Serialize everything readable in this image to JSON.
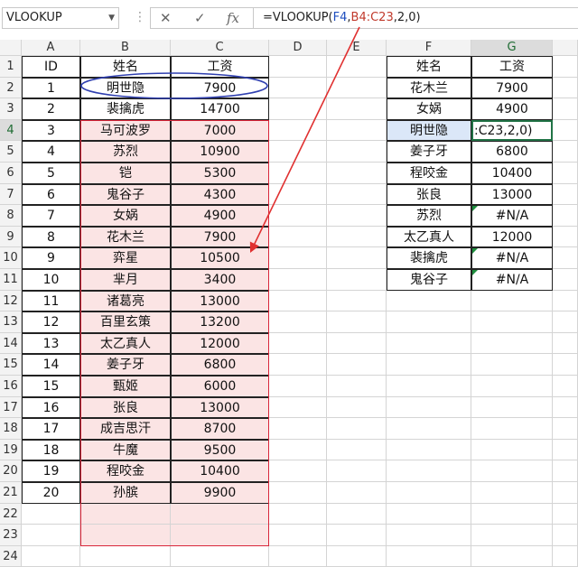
{
  "formula_bar": {
    "name_box": "VLOOKUP",
    "cancel_icon": "✕",
    "enter_icon": "✓",
    "fx_label": "fx",
    "formula_parts": [
      "=VLOOKUP(",
      "F4",
      ",",
      "B4:C23",
      ",2,0)"
    ]
  },
  "columns": [
    "A",
    "B",
    "C",
    "D",
    "E",
    "F",
    "G"
  ],
  "rows": [
    "1",
    "2",
    "3",
    "4",
    "5",
    "6",
    "7",
    "8",
    "9",
    "10",
    "11",
    "12",
    "13",
    "14",
    "15",
    "16",
    "17",
    "18",
    "19",
    "20",
    "21",
    "22",
    "23",
    "24"
  ],
  "left_table": {
    "headers": [
      "ID",
      "姓名",
      "工资"
    ],
    "rows": [
      [
        "1",
        "明世隐",
        "7900"
      ],
      [
        "2",
        "裴擒虎",
        "14700"
      ],
      [
        "3",
        "马可波罗",
        "7000"
      ],
      [
        "4",
        "苏烈",
        "10900"
      ],
      [
        "5",
        "铠",
        "5300"
      ],
      [
        "6",
        "鬼谷子",
        "4300"
      ],
      [
        "7",
        "女娲",
        "4900"
      ],
      [
        "8",
        "花木兰",
        "7900"
      ],
      [
        "9",
        "弈星",
        "10500"
      ],
      [
        "10",
        "芈月",
        "3400"
      ],
      [
        "11",
        "诸葛亮",
        "13000"
      ],
      [
        "12",
        "百里玄策",
        "13200"
      ],
      [
        "13",
        "太乙真人",
        "12000"
      ],
      [
        "14",
        "姜子牙",
        "6800"
      ],
      [
        "15",
        "甄姬",
        "6000"
      ],
      [
        "16",
        "张良",
        "13000"
      ],
      [
        "17",
        "成吉思汗",
        "8700"
      ],
      [
        "18",
        "牛魔",
        "9500"
      ],
      [
        "19",
        "程咬金",
        "10400"
      ],
      [
        "20",
        "孙膑",
        "9900"
      ]
    ]
  },
  "right_table": {
    "headers": [
      "姓名",
      "工资"
    ],
    "rows": [
      [
        "花木兰",
        "7900"
      ],
      [
        "女娲",
        "4900"
      ],
      [
        "明世隐",
        ":C23,2,0)"
      ],
      [
        "姜子牙",
        "6800"
      ],
      [
        "程咬金",
        "10400"
      ],
      [
        "张良",
        "13000"
      ],
      [
        "苏烈",
        "#N/A"
      ],
      [
        "太乙真人",
        "12000"
      ],
      [
        "裴擒虎",
        "#N/A"
      ],
      [
        "鬼谷子",
        "#N/A"
      ]
    ]
  },
  "colors": {
    "ref_blue": "#1f4fbf",
    "ref_red": "#d9263a",
    "range_fill": "#fbe4e4",
    "selection_green": "#217346"
  }
}
